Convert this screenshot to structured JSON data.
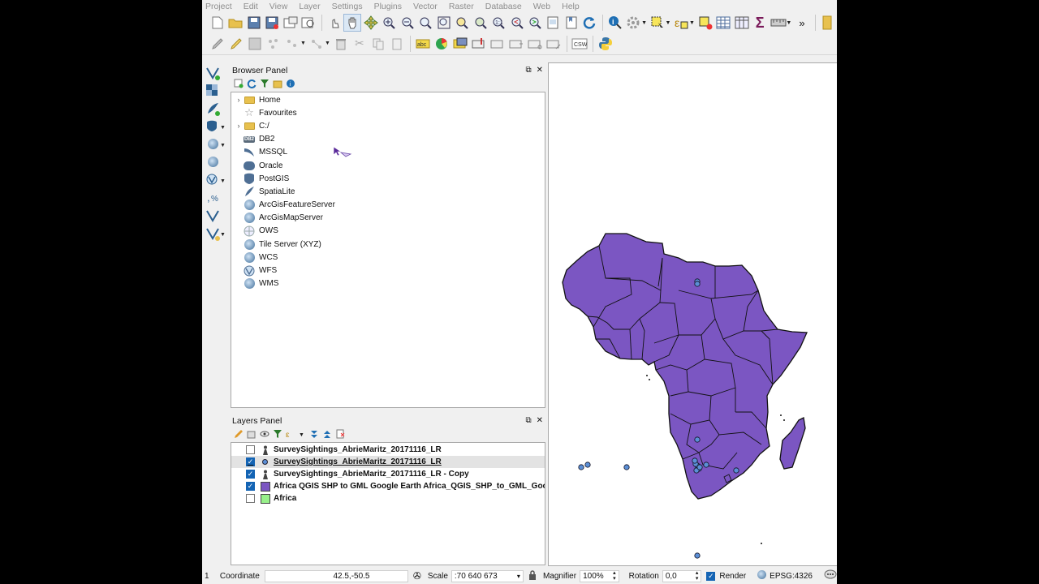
{
  "menu": [
    "Project",
    "Edit",
    "View",
    "Layer",
    "Settings",
    "Plugins",
    "Vector",
    "Raster",
    "Database",
    "Web",
    "Help"
  ],
  "toolbar": {
    "overflow_label": "»",
    "csw_label": "CSW",
    "abc_label": "abc"
  },
  "browser": {
    "title": "Browser Panel",
    "items": [
      {
        "label": "Home",
        "icon": "folder-icon",
        "expandable": true
      },
      {
        "label": "Favourites",
        "icon": "star-icon",
        "expandable": false
      },
      {
        "label": "C:/",
        "icon": "folder-icon",
        "expandable": true
      },
      {
        "label": "DB2",
        "icon": "db2-icon",
        "expandable": false
      },
      {
        "label": "MSSQL",
        "icon": "mssql-icon",
        "expandable": false
      },
      {
        "label": "Oracle",
        "icon": "oracle-icon",
        "expandable": false
      },
      {
        "label": "PostGIS",
        "icon": "postgis-icon",
        "expandable": false
      },
      {
        "label": "SpatiaLite",
        "icon": "spatialite-icon",
        "expandable": false
      },
      {
        "label": "ArcGisFeatureServer",
        "icon": "globe-icon",
        "expandable": false
      },
      {
        "label": "ArcGisMapServer",
        "icon": "globe-icon",
        "expandable": false
      },
      {
        "label": "OWS",
        "icon": "ows-icon",
        "expandable": false
      },
      {
        "label": "Tile Server (XYZ)",
        "icon": "globe-icon",
        "expandable": false
      },
      {
        "label": "WCS",
        "icon": "globe-icon",
        "expandable": false
      },
      {
        "label": "WFS",
        "icon": "wfs-icon",
        "expandable": false
      },
      {
        "label": "WMS",
        "icon": "globe-icon",
        "expandable": false
      }
    ],
    "db2_glyph": "DB2"
  },
  "layers": {
    "title": "Layers Panel",
    "items": [
      {
        "label": "SurveySightings_AbrieMaritz_20171116_LR",
        "checked": false,
        "symbol": "person",
        "selected": false
      },
      {
        "label": "SurveySightings_AbrieMaritz_20171116_LR",
        "checked": true,
        "symbol": "point",
        "selected": true
      },
      {
        "label": "SurveySightings_AbrieMaritz_20171116_LR - Copy",
        "checked": true,
        "symbol": "person",
        "selected": false
      },
      {
        "label": "Africa QGIS SHP to GML Google Earth Africa_QGIS_SHP_to_GML_Goo...",
        "checked": true,
        "symbol": "fill",
        "fill_color": "#7b56c2",
        "selected": false
      },
      {
        "label": "Africa",
        "checked": false,
        "symbol": "fill",
        "fill_color": "#98f08a",
        "selected": false
      }
    ]
  },
  "map": {
    "africa_fill": "#7b56c2",
    "point_fill": "#5b8fd6"
  },
  "status": {
    "message_count": "1",
    "coordinate_label": "Coordinate",
    "coordinate_value": "42.5,-50.5",
    "scale_label": "Scale",
    "scale_value": ":70 640 673",
    "magnifier_label": "Magnifier",
    "magnifier_value": "100%",
    "rotation_label": "Rotation",
    "rotation_value": "0,0",
    "render_label": "Render",
    "render_checked": true,
    "crs_label": "EPSG:4326"
  }
}
